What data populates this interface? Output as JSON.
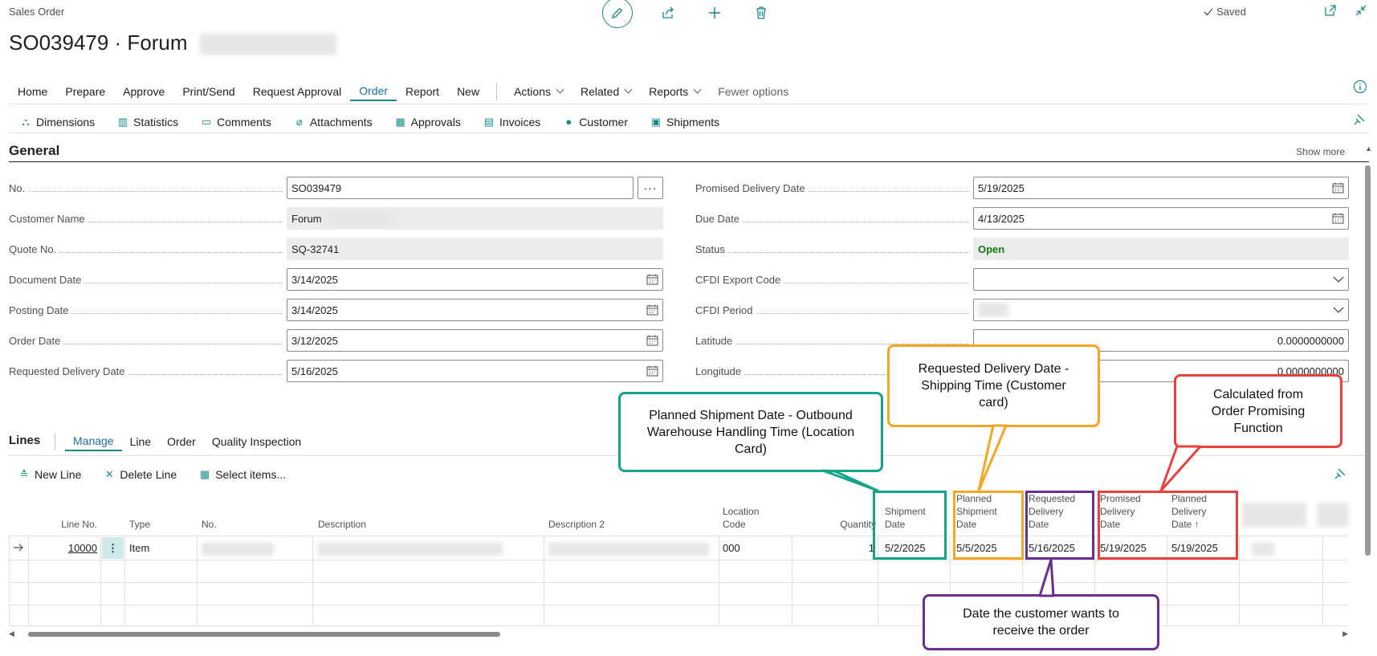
{
  "header": {
    "page_type": "Sales Order",
    "title": "SO039479 · Forum",
    "saved_label": "Saved"
  },
  "actions": {
    "menu": [
      "Home",
      "Prepare",
      "Approve",
      "Print/Send",
      "Request Approval",
      "Order",
      "Report",
      "New"
    ],
    "active": "Order",
    "dropdowns": [
      "Actions",
      "Related",
      "Reports"
    ],
    "fewer_options": "Fewer options",
    "promoted": [
      "Dimensions",
      "Statistics",
      "Comments",
      "Attachments",
      "Approvals",
      "Invoices",
      "Customer",
      "Shipments"
    ]
  },
  "general": {
    "title": "General",
    "show_more": "Show more",
    "left_fields": [
      {
        "label": "No.",
        "value": "SO039479"
      },
      {
        "label": "Customer Name",
        "value": "Forum"
      },
      {
        "label": "Quote No.",
        "value": "SQ-32741"
      },
      {
        "label": "Document Date",
        "value": "3/14/2025"
      },
      {
        "label": "Posting Date",
        "value": "3/14/2025"
      },
      {
        "label": "Order Date",
        "value": "3/12/2025"
      },
      {
        "label": "Requested Delivery Date",
        "value": "5/16/2025"
      }
    ],
    "right_fields": [
      {
        "label": "Promised Delivery Date",
        "value": "5/19/2025"
      },
      {
        "label": "Due Date",
        "value": "4/13/2025"
      },
      {
        "label": "Status",
        "value": "Open"
      },
      {
        "label": "CFDI Export Code",
        "value": ""
      },
      {
        "label": "CFDI Period",
        "value": ""
      },
      {
        "label": "Latitude",
        "value": "0.0000000000"
      },
      {
        "label": "Longitude",
        "value": "0.0000000000"
      }
    ]
  },
  "lines": {
    "title": "Lines",
    "tabs": [
      "Manage",
      "Line",
      "Order",
      "Quality Inspection"
    ],
    "active_tab": "Manage",
    "actions": [
      "New Line",
      "Delete Line",
      "Select items..."
    ],
    "columns": [
      "Line No.",
      "Type",
      "No.",
      "Description",
      "Description 2",
      "Location Code",
      "Quantity",
      "Shipment Date",
      "Planned Shipment Date",
      "Requested Delivery Date",
      "Promised Delivery Date",
      "Planned Delivery Date ↑"
    ],
    "row": {
      "line_no": "10000",
      "type": "Item",
      "location_code": "000",
      "quantity": "1",
      "shipment_date": "5/2/2025",
      "planned_shipment_date": "5/5/2025",
      "requested_delivery_date": "5/16/2025",
      "promised_delivery_date": "5/19/2025",
      "planned_delivery_date": "5/19/2025"
    }
  },
  "annotations": {
    "teal": "Planned Shipment Date - Outbound Warehouse Handling Time (Location Card)",
    "orange": "Requested Delivery Date - Shipping Time (Customer card)",
    "red": "Calculated from Order Promising Function",
    "purple": "Date the customer wants to receive the order",
    "colors": {
      "teal": "#13a58a",
      "orange": "#f5a623",
      "red": "#e8403c",
      "purple": "#6b2e91",
      "accent": "#1b8a8a"
    }
  }
}
